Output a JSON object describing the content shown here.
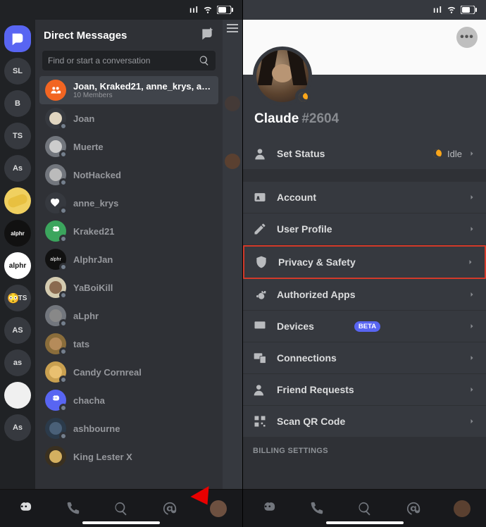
{
  "left": {
    "dm_header": "Direct Messages",
    "search_placeholder": "Find or start a conversation",
    "server_labels": [
      "SL",
      "B",
      "TS",
      "As",
      "",
      "alphr",
      "alphr",
      "TS",
      "AS",
      "as",
      "",
      "As"
    ],
    "group": {
      "name": "Joan, Kraked21, anne_krys, aLph...",
      "sub": "10 Members"
    },
    "dms": [
      "Joan",
      "Muerte",
      "NotHacked",
      "anne_krys",
      "Kraked21",
      "AlphrJan",
      "YaBoiKill",
      "aLphr",
      "tats",
      "Candy Cornreal",
      "chacha",
      "ashbourne",
      "King Lester X"
    ]
  },
  "right": {
    "username": "Claude",
    "tag": "#2604",
    "status_row": {
      "label": "Set Status",
      "value": "Idle"
    },
    "rows": [
      "Account",
      "User Profile",
      "Privacy & Safety",
      "Authorized Apps",
      "Devices",
      "Connections",
      "Friend Requests",
      "Scan QR Code"
    ],
    "beta": "BETA",
    "billing_title": "BILLING SETTINGS"
  }
}
